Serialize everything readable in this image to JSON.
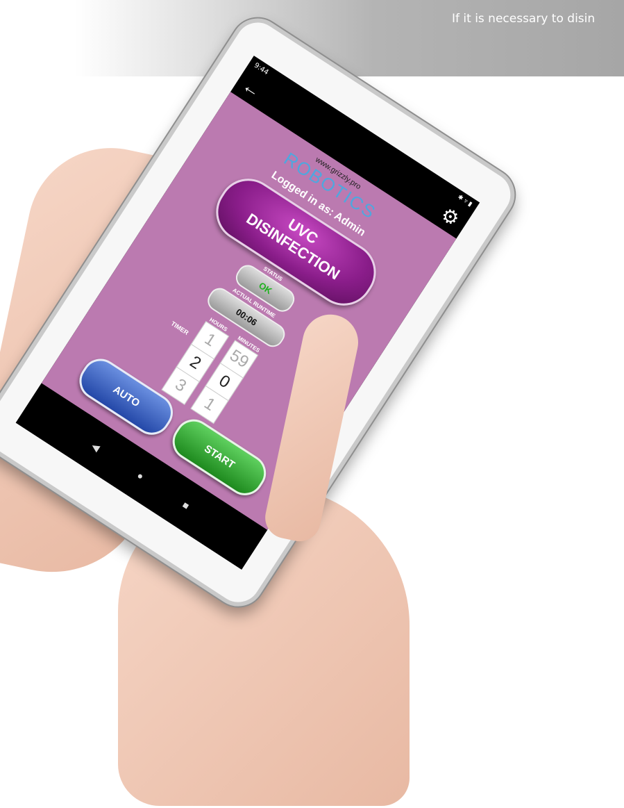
{
  "banner": {
    "text": "If it is necessary to disin"
  },
  "device": {
    "status_bar": {
      "time": "9:44",
      "icons": "✱ ▿ ▮"
    },
    "app_bar": {
      "back_icon": "arrow-left-icon",
      "settings_icon": "gear-icon"
    },
    "header": {
      "url": "www.grizzly.pro",
      "brand": "ROBOTICS",
      "logged_in": "Logged in as: Admin"
    },
    "title_button": {
      "line1": "UVC",
      "line2": "DISINFECTION"
    },
    "status": {
      "label": "STATUS",
      "value": "OK",
      "value_color": "#1cb11c"
    },
    "runtime": {
      "label": "ACTUAL RUNTIME",
      "value": "00:06"
    },
    "timer": {
      "label": "TIMER",
      "hours_label": "HOURS",
      "minutes_label": "MINUTES",
      "hours": [
        "1",
        "2",
        "3"
      ],
      "minutes": [
        "59",
        "0",
        "1"
      ]
    },
    "buttons": {
      "start": "START",
      "auto": "AUTO"
    },
    "nav": {
      "back": "◀",
      "home": "●",
      "recents": "■"
    }
  },
  "colors": {
    "screen_bg": "#bb7ab0",
    "title_button": "#8a1d8a",
    "start_button": "#2ea82e",
    "auto_button": "#3b5fc4",
    "brand": "#4fa7de"
  }
}
